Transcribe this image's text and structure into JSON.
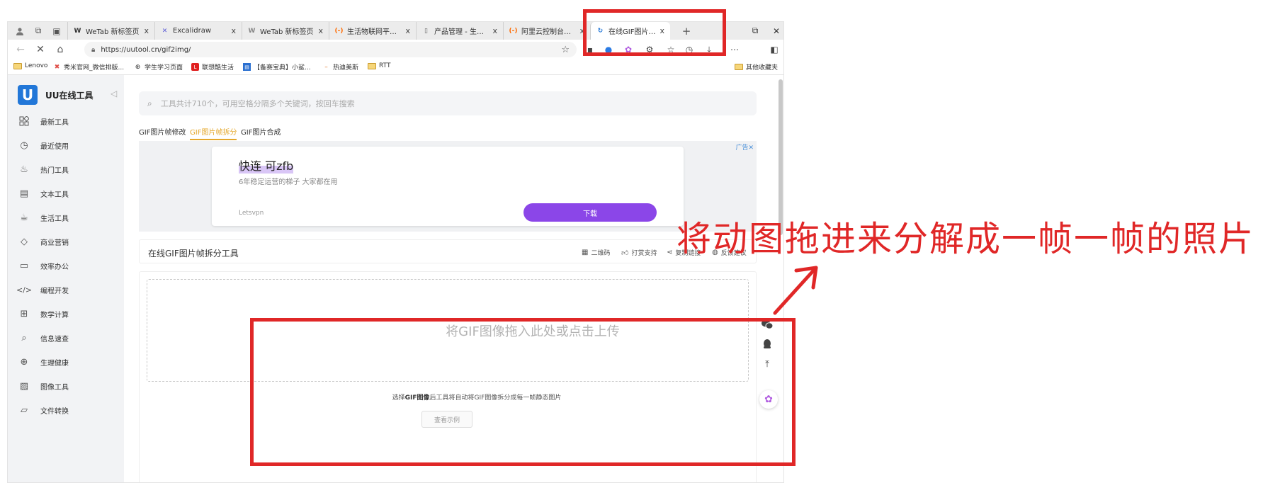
{
  "browser": {
    "tabs": [
      {
        "title": "WeTab 新标签页",
        "favicon": "W"
      },
      {
        "title": "Excalidraw",
        "favicon": "✕"
      },
      {
        "title": "WeTab 新标签页",
        "favicon": "W"
      },
      {
        "title": "生活物联网平台_智...",
        "favicon": "(-)"
      },
      {
        "title": "产品管理 - 生活物联...",
        "favicon": "▯"
      },
      {
        "title": "阿里云控制台首页",
        "favicon": "(-)"
      },
      {
        "title": "在线GIF图片帧拆分",
        "favicon": "↻"
      }
    ],
    "close_glyph": "x",
    "new_tab_glyph": "+",
    "url": "https://uutool.cn/gif2img/",
    "bookmarks": [
      {
        "label": "Lenovo",
        "icon": "folder"
      },
      {
        "label": "秀米官网_微信排版...",
        "icon": "xiumi"
      },
      {
        "label": "学生学习页面",
        "icon": "globe"
      },
      {
        "label": "联想酷生活",
        "icon": "lenovo"
      },
      {
        "label": "【备赛宝典】小鲨...",
        "icon": "doc"
      },
      {
        "label": "热迪美斯",
        "icon": "dash"
      },
      {
        "label": "RTT",
        "icon": "folder"
      },
      {
        "label": "其他收藏夹",
        "icon": "folder"
      }
    ]
  },
  "site": {
    "logo_letter": "U",
    "name": "UU在线工具",
    "sidebar": [
      {
        "label": "最新工具",
        "icon": "grid-icon"
      },
      {
        "label": "最近使用",
        "icon": "clock-icon"
      },
      {
        "label": "热门工具",
        "icon": "fire-icon"
      },
      {
        "label": "文本工具",
        "icon": "document-icon"
      },
      {
        "label": "生活工具",
        "icon": "cup-icon"
      },
      {
        "label": "商业营销",
        "icon": "diamond-icon"
      },
      {
        "label": "效率办公",
        "icon": "monitor-icon"
      },
      {
        "label": "编程开发",
        "icon": "code-icon"
      },
      {
        "label": "数学计算",
        "icon": "calculator-icon"
      },
      {
        "label": "信息速查",
        "icon": "search-doc-icon"
      },
      {
        "label": "生理健康",
        "icon": "medkit-icon"
      },
      {
        "label": "图像工具",
        "icon": "image-icon"
      },
      {
        "label": "文件转换",
        "icon": "folder-icon"
      }
    ],
    "search_placeholder": "工具共计710个，可用空格分隔多个关键词，按回车搜索",
    "subtabs": [
      "GIF图片帧修改",
      "GIF图片帧拆分",
      "GIF图片合成"
    ],
    "active_subtab": "GIF图片帧拆分",
    "ad": {
      "title": "快连 可zfb",
      "subtitle": "6年稳定运营的梯子 大家都在用",
      "brand": "Letsvpn",
      "button": "下载",
      "mark": "广告✕"
    },
    "tool": {
      "title": "在线GIF图片帧拆分工具",
      "actions": [
        "二维码",
        "打赏支持",
        "复制链接",
        "反馈建议"
      ]
    },
    "dropzone_text": "将GIF图像拖入此处或点击上传",
    "hint_pre": "选择",
    "hint_bold": "GIF图像",
    "hint_post": "后工具将自动将GIF图像拆分成每一帧静态图片",
    "example_button": "查看示例"
  },
  "annotation": {
    "text": "将动图拖进来分解成一帧一帧的照片",
    "color": "#e02727"
  }
}
